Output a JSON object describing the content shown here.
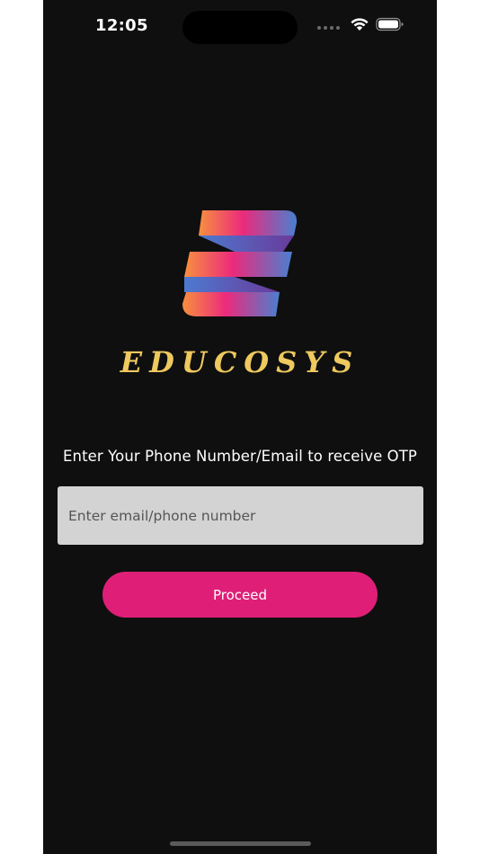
{
  "status_bar": {
    "time": "12:05",
    "icons": [
      "signal-dots-icon",
      "wifi-icon",
      "battery-icon"
    ]
  },
  "brand": {
    "logo_icon": "educosys-logo-icon",
    "name": "EDUCOSYS"
  },
  "login": {
    "prompt": "Enter Your Phone Number/Email to receive OTP",
    "input_placeholder": "Enter email/phone number",
    "input_value": "",
    "proceed_label": "Proceed"
  },
  "colors": {
    "background": "#0f0f0f",
    "brand_text": "#eec95f",
    "button": "#df1f77",
    "input_bg": "#d3d3d3"
  }
}
